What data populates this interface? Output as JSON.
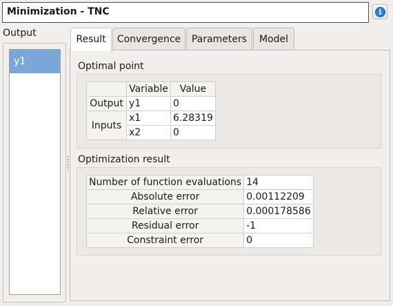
{
  "window": {
    "title": "Minimization - TNC",
    "info_icon": "info-icon",
    "info_glyph": "i"
  },
  "output": {
    "label": "Output",
    "items": [
      "y1"
    ]
  },
  "tabs": [
    {
      "label": "Result",
      "active": true
    },
    {
      "label": "Convergence",
      "active": false
    },
    {
      "label": "Parameters",
      "active": false
    },
    {
      "label": "Model",
      "active": false
    }
  ],
  "optimal_point": {
    "title": "Optimal point",
    "headers": [
      "Variable",
      "Value"
    ],
    "output_label": "Output",
    "inputs_label": "Inputs",
    "output_row": {
      "variable": "y1",
      "value": "0"
    },
    "input_rows": [
      {
        "variable": "x1",
        "value": "6.28319"
      },
      {
        "variable": "x2",
        "value": "0"
      }
    ]
  },
  "optimization_result": {
    "title": "Optimization result",
    "rows": [
      {
        "label": "Number of function evaluations",
        "value": "14"
      },
      {
        "label": "Absolute error",
        "value": "0.00112209"
      },
      {
        "label": "Relative error",
        "value": "0.000178586"
      },
      {
        "label": "Residual error",
        "value": "-1"
      },
      {
        "label": "Constraint error",
        "value": "0"
      }
    ]
  },
  "colors": {
    "selection": "#7ba7d8",
    "info_icon": "#2f7bd6",
    "title_border": "#4a4a4a"
  }
}
